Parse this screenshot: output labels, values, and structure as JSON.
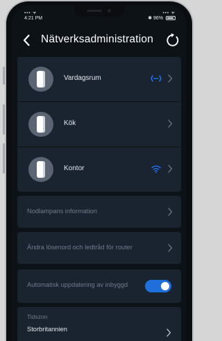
{
  "status_bar": {
    "time": "4:21 PM",
    "bluetooth": "✱",
    "battery_percent": "96%"
  },
  "nav": {
    "title": "Nätverksadministration",
    "back_icon": "chevron-left-icon",
    "refresh_icon": "refresh-icon"
  },
  "nodes": [
    {
      "label": "Vardagsrum",
      "status_icon": "ethernet-dots-icon",
      "status_color": "#1e78ff"
    },
    {
      "label": "Kök",
      "status_icon": "",
      "status_color": ""
    },
    {
      "label": "Kontor",
      "status_icon": "wifi-icon",
      "status_color": "#1e78ff"
    }
  ],
  "menu": {
    "node_light_info": "Nodlampans information",
    "change_password": "Ändra lösenord och ledtråd för router",
    "auto_update": "Automatisk uppdatering av inbyggd",
    "auto_update_enabled": true
  },
  "timezone": {
    "header": "Tidszon",
    "value": "Storbritannien"
  },
  "colors": {
    "background": "#0d1217",
    "card": "#1a2330",
    "accent": "#1e6fdc",
    "muted_text": "#6f7c8b"
  }
}
